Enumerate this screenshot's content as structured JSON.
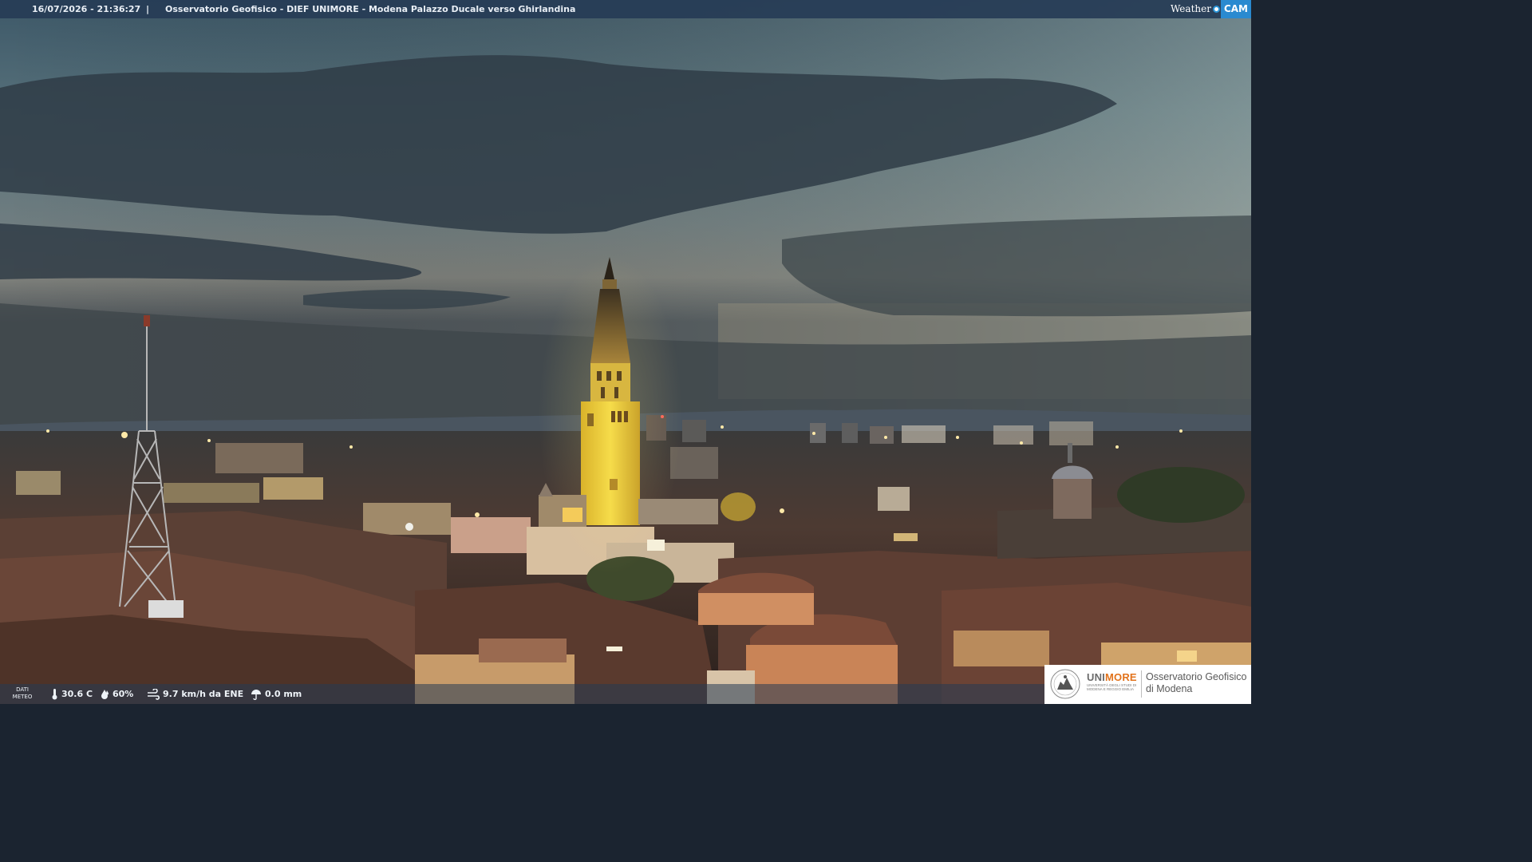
{
  "overlay": {
    "timestamp": "16/07/2026 - 21:36:27",
    "separator": "|",
    "title": "Osservatorio Geofisico - DIEF UNIMORE - Modena Palazzo Ducale verso Ghirlandina",
    "brand_weather": "Weather",
    "brand_cam": "CAM"
  },
  "weather": {
    "dati_line1": "DATI",
    "dati_line2": "METEO",
    "temperature": "30.6 C",
    "humidity": "60%",
    "wind": "9.7 km/h da ENE",
    "rain": "0.0 mm"
  },
  "logo": {
    "uni": "UNI",
    "more": "MORE",
    "subline1": "UNIVERSITÀ DEGLI STUDI DI",
    "subline2": "MODENA E REGGIO EMILIA",
    "obs_line1": "Osservatorio Geofisico",
    "obs_line2": "di Modena"
  },
  "colors": {
    "bar_bg": "#263c56",
    "brand_blue": "#2a8ad0",
    "unimore_orange": "#e2731c",
    "tower_light": "#f2d23a"
  },
  "icons": {
    "temperature": "thermometer-icon",
    "humidity": "drop-icon",
    "wind": "wind-icon",
    "rain": "umbrella-icon"
  }
}
